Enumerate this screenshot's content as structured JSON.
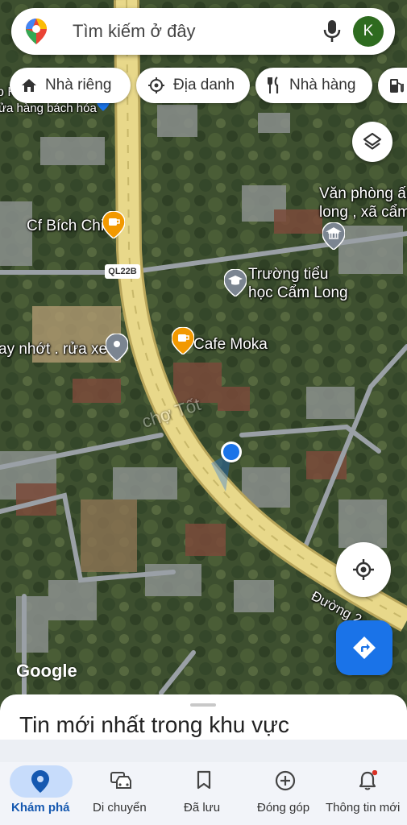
{
  "search": {
    "placeholder": "Tìm kiếm ở đây",
    "avatar_letter": "K"
  },
  "chips": [
    {
      "label": "Nhà riêng",
      "icon": "home-icon"
    },
    {
      "label": "Địa danh",
      "icon": "landmark-icon"
    },
    {
      "label": "Nhà hàng",
      "icon": "restaurant-icon"
    },
    {
      "label": "",
      "icon": "gas-station-icon"
    }
  ],
  "map": {
    "labels": {
      "top_left_partial": "p H",
      "store": "ửa hàng bách hóa",
      "cafe_bich_chi": "Cf Bích Chi",
      "office_line1": "Văn phòng ấp",
      "office_line2": "long , xã cẩm",
      "school_line1": "Trường tiểu",
      "school_line2": "học Cẩm Long",
      "cafe_moka": "Cafe Moka",
      "oil_shop": "ay nhớt . rửa xe",
      "road_name": "Đường 2",
      "road_shield": "QL22B",
      "watermark": "chợ Tốt"
    },
    "attribution": "Google",
    "colors": {
      "road_fill": "#e8d88a",
      "road_edge": "#b8a55a",
      "accent": "#1a73e8",
      "poi_cafe": "#f29900",
      "poi_gray": "#7b8591"
    }
  },
  "sheet": {
    "title": "Tin mới nhất trong khu vực"
  },
  "bottom_nav": [
    {
      "label": "Khám phá",
      "icon": "explore-pin-icon",
      "active": true
    },
    {
      "label": "Di chuyển",
      "icon": "car-icon",
      "active": false
    },
    {
      "label": "Đã lưu",
      "icon": "bookmark-icon",
      "active": false
    },
    {
      "label": "Đóng góp",
      "icon": "add-circle-icon",
      "active": false
    },
    {
      "label": "Thông tin mới",
      "icon": "bell-icon",
      "active": false
    }
  ]
}
